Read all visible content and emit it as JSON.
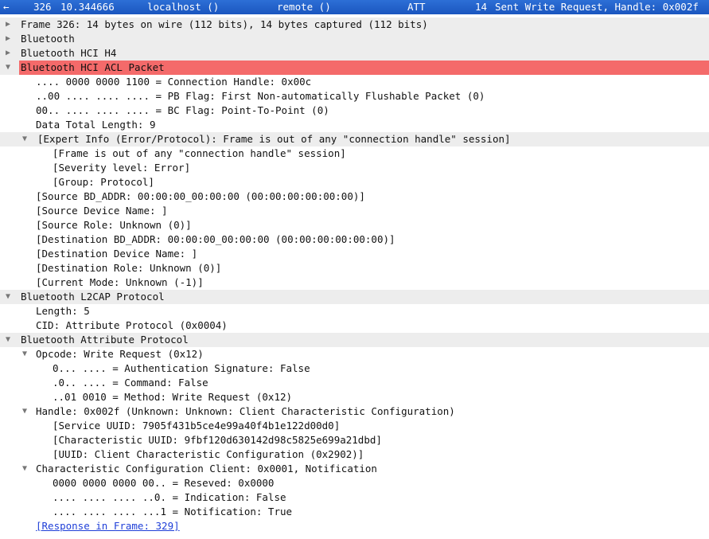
{
  "packet_bar": {
    "arrow": "←",
    "number": "326",
    "time": "10.344666",
    "source": "localhost ()",
    "destination": "remote ()",
    "protocol": "ATT",
    "length": "14",
    "info": "Sent Write Request, Handle: 0x002f"
  },
  "tree": [
    {
      "text": "Frame 326: 14 bytes on wire (112 bits), 14 bytes captured (112 bits)",
      "state": "collapsed",
      "section": true
    },
    {
      "text": "Bluetooth",
      "state": "collapsed",
      "section": true
    },
    {
      "text": "Bluetooth HCI H4",
      "state": "collapsed",
      "section": true
    },
    {
      "text": "Bluetooth HCI ACL Packet",
      "state": "expanded",
      "section": true,
      "highlight": true
    },
    {
      "text": ".... 0000 0000 1100 = Connection Handle: 0x00c"
    },
    {
      "text": "..00 .... .... .... = PB Flag: First Non-automatically Flushable Packet (0)"
    },
    {
      "text": "00.. .... .... .... = BC Flag: Point-To-Point (0)"
    },
    {
      "text": "Data Total Length: 9"
    },
    {
      "text": "[Expert Info (Error/Protocol): Frame is out of any \"connection handle\" session]",
      "state": "expanded",
      "section": true
    },
    {
      "text": "[Frame is out of any \"connection handle\" session]"
    },
    {
      "text": "[Severity level: Error]"
    },
    {
      "text": "[Group: Protocol]"
    },
    {
      "text": "[Source BD_ADDR: 00:00:00_00:00:00 (00:00:00:00:00:00)]"
    },
    {
      "text": "[Source Device Name: ]"
    },
    {
      "text": "[Source Role: Unknown (0)]"
    },
    {
      "text": "[Destination BD_ADDR: 00:00:00_00:00:00 (00:00:00:00:00:00)]"
    },
    {
      "text": "[Destination Device Name: ]"
    },
    {
      "text": "[Destination Role: Unknown (0)]"
    },
    {
      "text": "[Current Mode: Unknown (-1)]"
    },
    {
      "text": "Bluetooth L2CAP Protocol",
      "state": "expanded",
      "section": true
    },
    {
      "text": "Length: 5"
    },
    {
      "text": "CID: Attribute Protocol (0x0004)"
    },
    {
      "text": "Bluetooth Attribute Protocol",
      "state": "expanded",
      "section": true
    },
    {
      "text": "Opcode: Write Request (0x12)",
      "state": "expanded"
    },
    {
      "text": "0... .... = Authentication Signature: False"
    },
    {
      "text": ".0.. .... = Command: False"
    },
    {
      "text": "..01 0010 = Method: Write Request (0x12)"
    },
    {
      "text": "Handle: 0x002f (Unknown: Unknown: Client Characteristic Configuration)",
      "state": "expanded"
    },
    {
      "text": "[Service UUID: 7905f431b5ce4e99a40f4b1e122d00d0]"
    },
    {
      "text": "[Characteristic UUID: 9fbf120d630142d98c5825e699a21dbd]"
    },
    {
      "text": "[UUID: Client Characteristic Configuration (0x2902)]"
    },
    {
      "text": "Characteristic Configuration Client: 0x0001, Notification",
      "state": "expanded"
    },
    {
      "text": "0000 0000 0000 00.. = Reseved: 0x0000"
    },
    {
      "text": ".... .... .... ..0. = Indication: False"
    },
    {
      "text": ".... .... .... ...1 = Notification: True"
    },
    {
      "text": "[Response in Frame: 329]",
      "link": true
    }
  ],
  "colors": {
    "selection": "#1b56bf",
    "error_highlight": "#f46a6a",
    "section_background": "#ededed",
    "link": "#1f3fd8"
  }
}
